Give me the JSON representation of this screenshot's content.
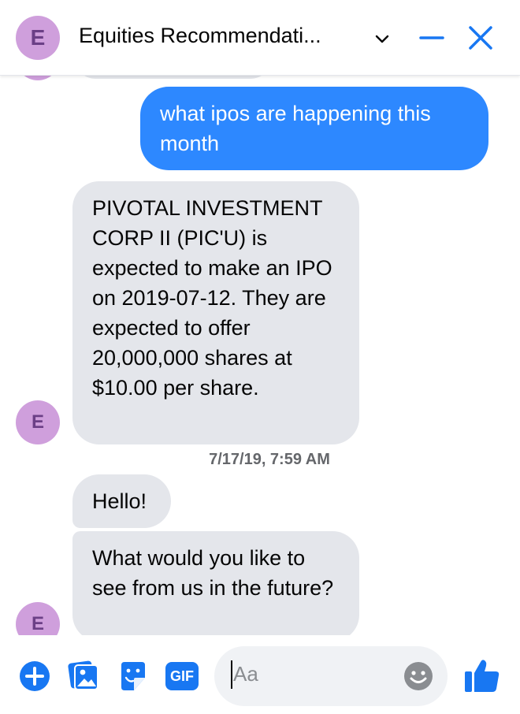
{
  "header": {
    "avatar_letter": "E",
    "title": "Equities Recommendati..."
  },
  "messages": [
    {
      "direction": "outgoing",
      "text": "what ipos are happening this month"
    },
    {
      "direction": "incoming",
      "text": "PIVOTAL INVESTMENT CORP II (PIC'U) is expected to make an IPO on 2019-07-12. They are expected to offer 20,000,000 shares at $10.00 per share."
    },
    {
      "timestamp": "7/17/19, 7:59 AM"
    },
    {
      "direction": "incoming",
      "text": "Hello!"
    },
    {
      "direction": "incoming",
      "text": "What would you like to see from us in the future?"
    }
  ],
  "avatar_letter": "E",
  "composer": {
    "placeholder": "Aa",
    "gif_label": "GIF",
    "icons": [
      "plus-circle-icon",
      "photo-icon",
      "sticker-icon",
      "gif-icon",
      "emoji-icon",
      "thumbs-up-icon"
    ]
  },
  "colors": {
    "accent": "#1877f2",
    "outgoing_bubble": "#2d88ff",
    "incoming_bubble": "#e4e6eb",
    "avatar_bg": "#cf9fdc",
    "avatar_text": "#6b3f86"
  }
}
